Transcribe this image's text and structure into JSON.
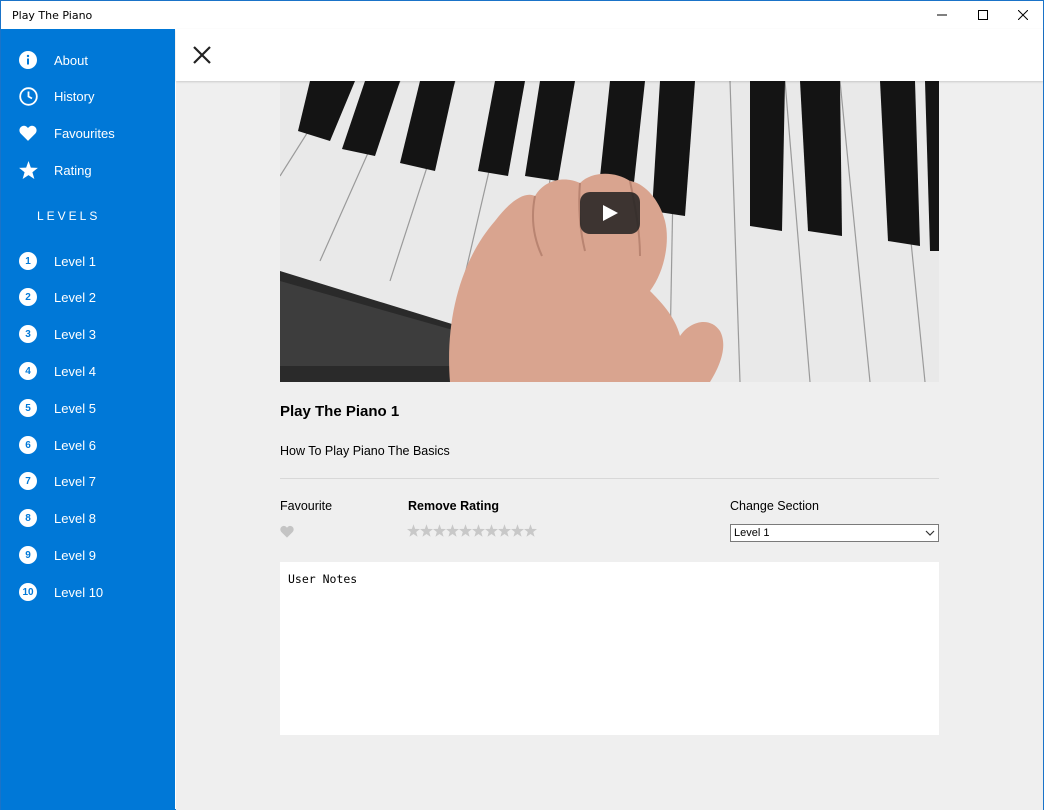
{
  "window": {
    "title": "Play The Piano"
  },
  "sidebar": {
    "menu": [
      {
        "label": "About",
        "icon": "info-icon"
      },
      {
        "label": "History",
        "icon": "clock-icon"
      },
      {
        "label": "Favourites",
        "icon": "heart-icon"
      },
      {
        "label": "Rating",
        "icon": "star-icon"
      }
    ],
    "levels_header": "LEVELS",
    "levels": [
      {
        "num": "1",
        "label": "Level 1"
      },
      {
        "num": "2",
        "label": "Level 2"
      },
      {
        "num": "3",
        "label": "Level 3"
      },
      {
        "num": "4",
        "label": "Level 4"
      },
      {
        "num": "5",
        "label": "Level 5"
      },
      {
        "num": "6",
        "label": "Level 6"
      },
      {
        "num": "7",
        "label": "Level 7"
      },
      {
        "num": "8",
        "label": "Level 8"
      },
      {
        "num": "9",
        "label": "Level 9"
      },
      {
        "num": "10",
        "label": "Level 10"
      }
    ],
    "accent_color": "#0078d7"
  },
  "video": {
    "title": "Play The Piano 1",
    "description": "How To Play Piano The Basics"
  },
  "controls": {
    "favourite_label": "Favourite",
    "rating_label": "Remove Rating",
    "rating_stars_total": 10,
    "rating_value": 0,
    "section_label": "Change Section",
    "section_selected": "Level 1"
  },
  "notes": {
    "value": "User Notes"
  }
}
